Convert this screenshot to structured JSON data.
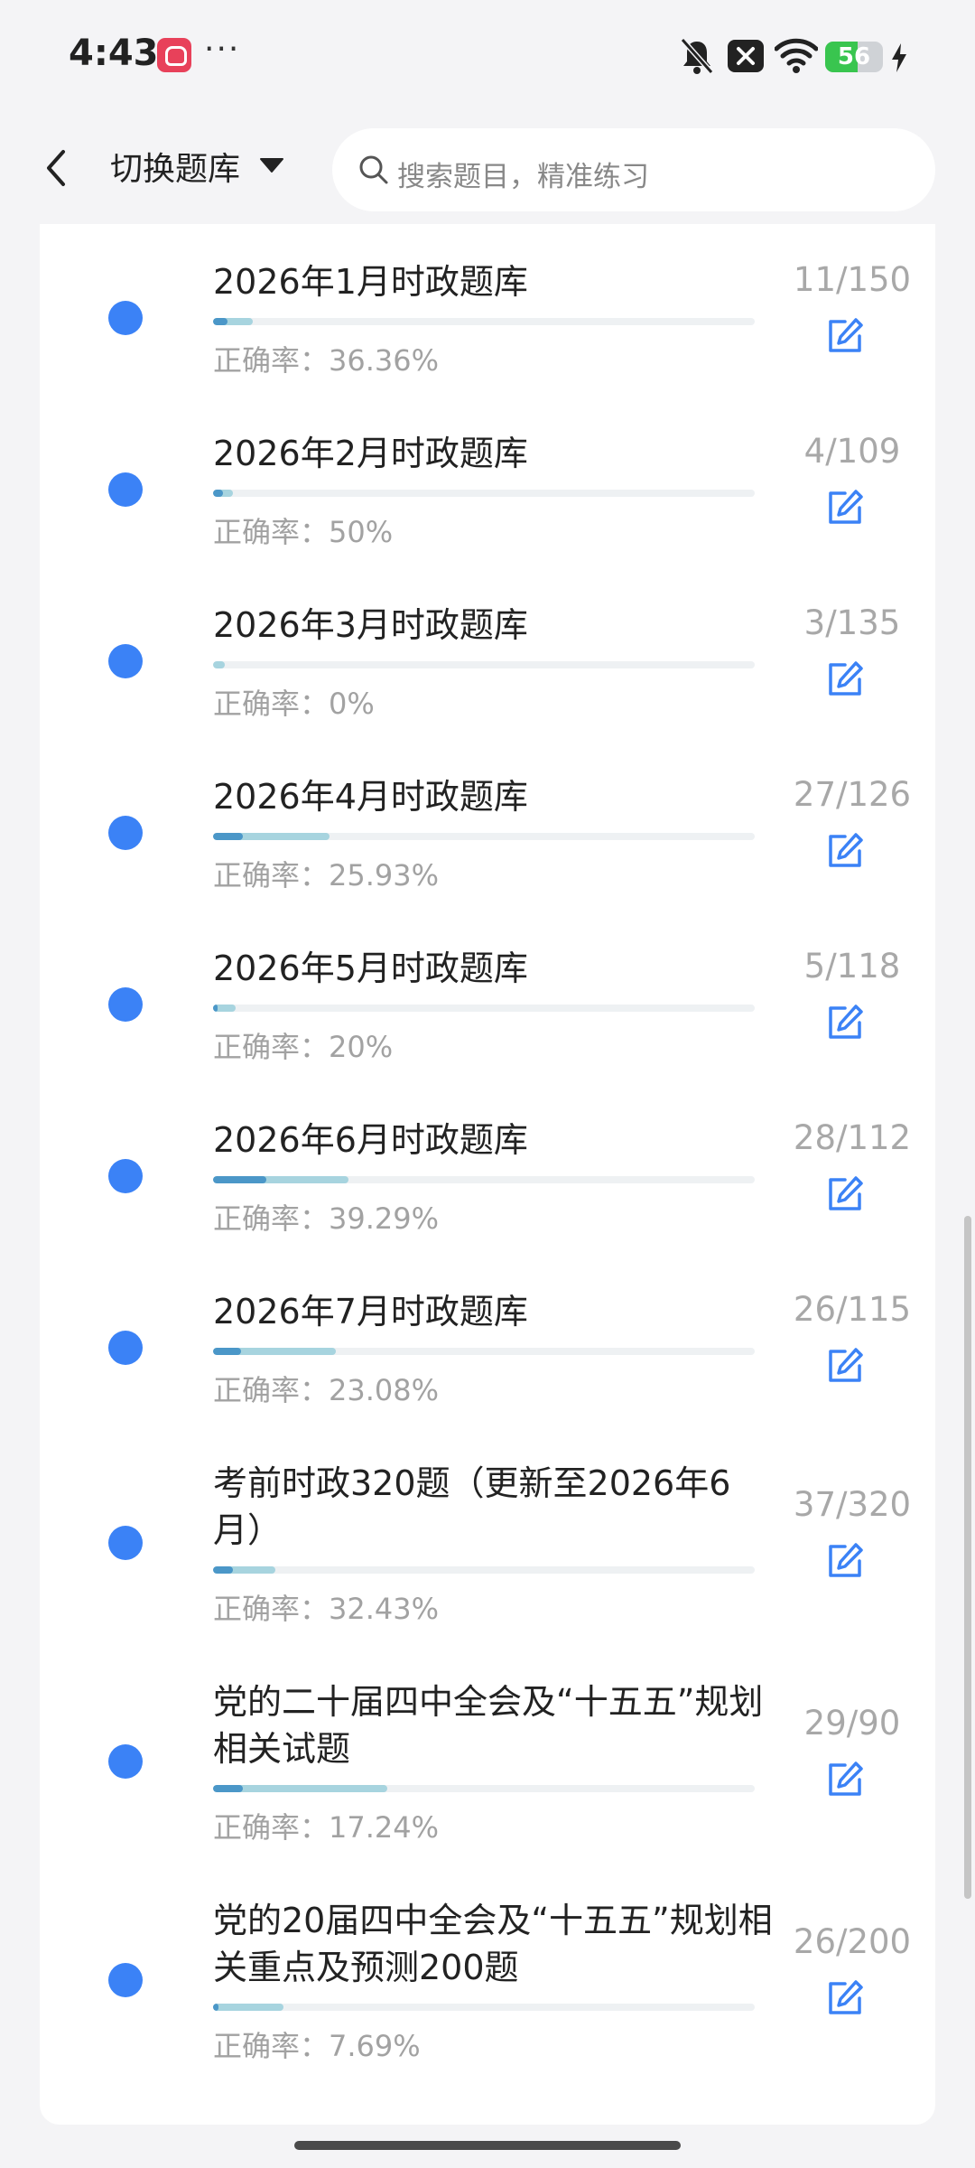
{
  "status_bar": {
    "time": "4:43",
    "battery_percent": "56",
    "battery_level": 0.56
  },
  "nav": {
    "title": "切换题库",
    "search_placeholder": "搜索题目，精准练习"
  },
  "colors": {
    "dot": "#3b82f6",
    "edit_icon": "#3b82f6",
    "progress_dark": "#4b97c8",
    "progress_light": "#a7d4df"
  },
  "items": [
    {
      "title": "2026年1月时政题库",
      "accuracy": "正确率：36.36%",
      "count": "11/150",
      "done": 11,
      "total": 150,
      "correct_rate": 0.3636
    },
    {
      "title": "2026年2月时政题库",
      "accuracy": "正确率：50%",
      "count": "4/109",
      "done": 4,
      "total": 109,
      "correct_rate": 0.5
    },
    {
      "title": "2026年3月时政题库",
      "accuracy": "正确率：0%",
      "count": "3/135",
      "done": 3,
      "total": 135,
      "correct_rate": 0.0
    },
    {
      "title": "2026年4月时政题库",
      "accuracy": "正确率：25.93%",
      "count": "27/126",
      "done": 27,
      "total": 126,
      "correct_rate": 0.2593
    },
    {
      "title": "2026年5月时政题库",
      "accuracy": "正确率：20%",
      "count": "5/118",
      "done": 5,
      "total": 118,
      "correct_rate": 0.2
    },
    {
      "title": "2026年6月时政题库",
      "accuracy": "正确率：39.29%",
      "count": "28/112",
      "done": 28,
      "total": 112,
      "correct_rate": 0.3929
    },
    {
      "title": "2026年7月时政题库",
      "accuracy": "正确率：23.08%",
      "count": "26/115",
      "done": 26,
      "total": 115,
      "correct_rate": 0.2308
    },
    {
      "title": "考前时政320题（更新至2026年6月）",
      "accuracy": "正确率：32.43%",
      "count": "37/320",
      "done": 37,
      "total": 320,
      "correct_rate": 0.3243
    },
    {
      "title": "党的二十届四中全会及“十五五”规划相关试题",
      "accuracy": "正确率：17.24%",
      "count": "29/90",
      "done": 29,
      "total": 90,
      "correct_rate": 0.1724
    },
    {
      "title": "党的20届四中全会及“十五五”规划相关重点及预测200题",
      "accuracy": "正确率：7.69%",
      "count": "26/200",
      "done": 26,
      "total": 200,
      "correct_rate": 0.0769
    }
  ]
}
